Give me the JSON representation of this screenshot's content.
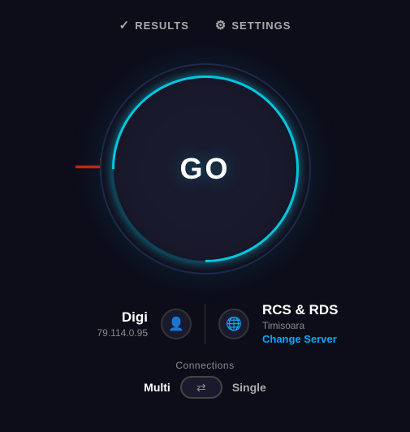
{
  "nav": {
    "results_label": "RESULTS",
    "settings_label": "SETTINGS"
  },
  "gauge": {
    "go_label": "GO"
  },
  "user_info": {
    "name": "Digi",
    "ip": "79.114.0.95"
  },
  "server_info": {
    "name": "RCS & RDS",
    "location": "Timisoara",
    "change_server_label": "Change Server"
  },
  "connections": {
    "label": "Connections",
    "multi_label": "Multi",
    "single_label": "Single"
  },
  "colors": {
    "accent": "#00c8e0",
    "link": "#00aaff",
    "bg": "#0d0d1a"
  }
}
